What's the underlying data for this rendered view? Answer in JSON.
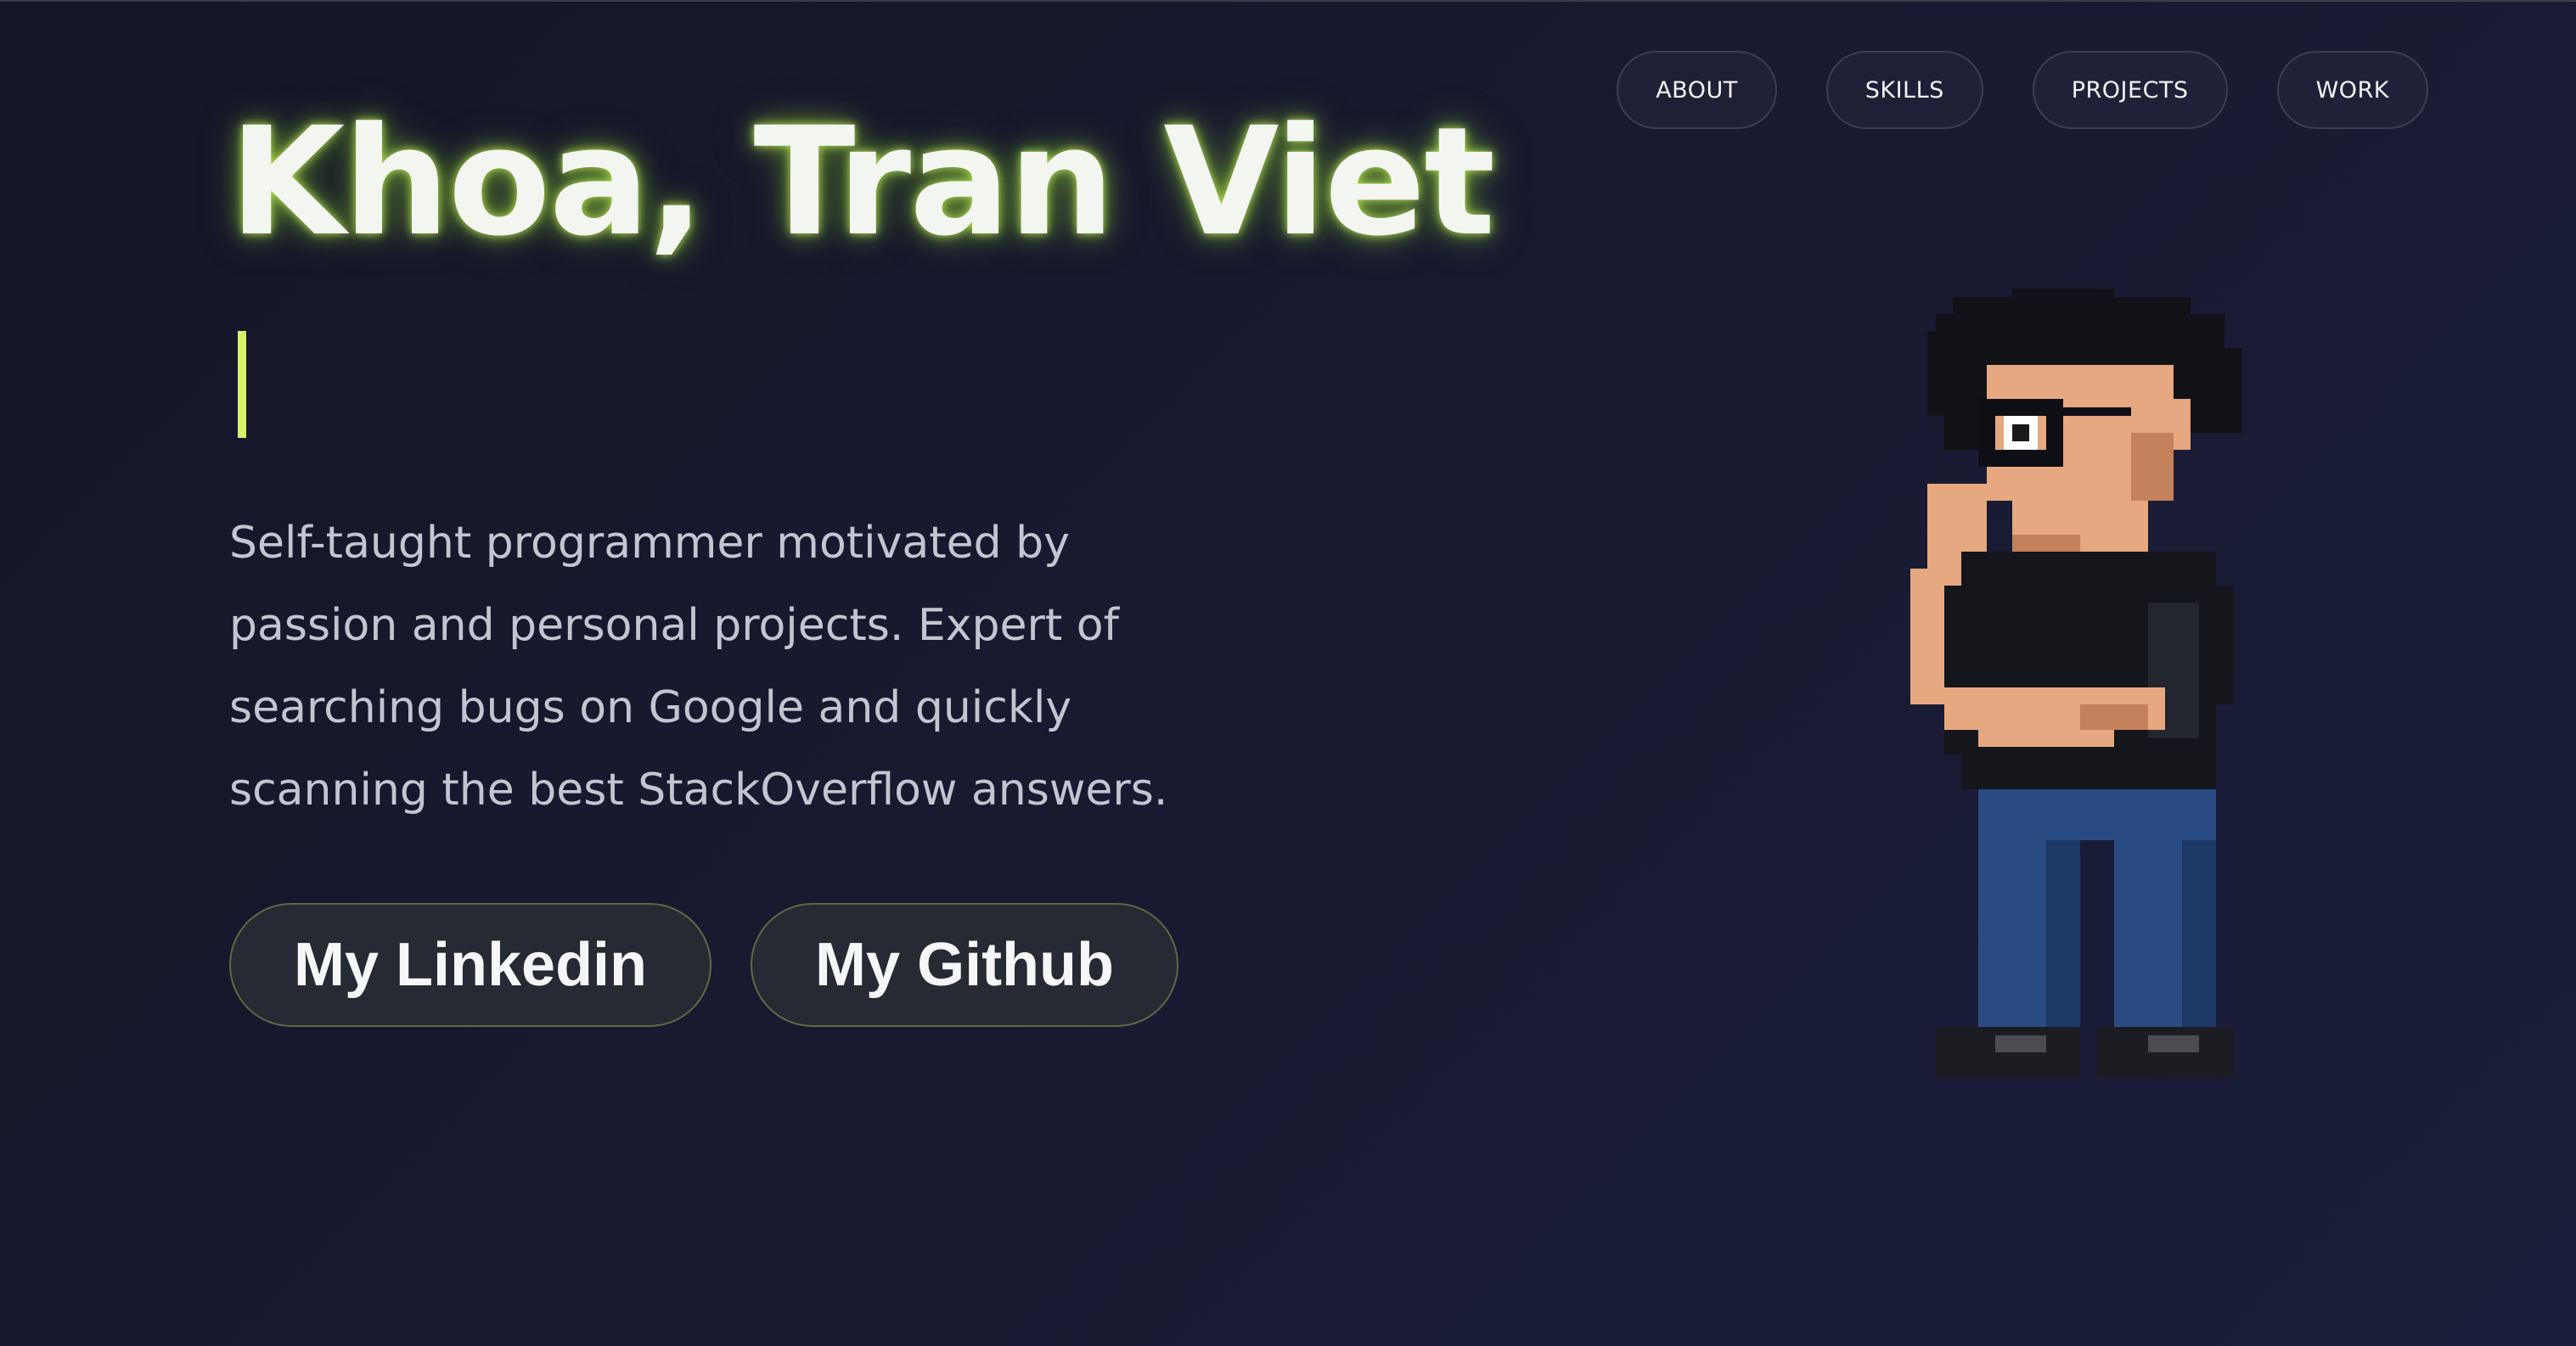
{
  "nav": {
    "items": [
      {
        "label": "ABOUT"
      },
      {
        "label": "SKILLS"
      },
      {
        "label": "PROJECTS"
      },
      {
        "label": "WORK"
      }
    ]
  },
  "hero": {
    "name": "Khoa, Tran Viet",
    "bio": "Self-taught programmer motivated by passion and personal projects. Expert of searching bugs on Google and quickly scanning the best StackOverflow answers.",
    "buttons": {
      "linkedin": "My Linkedin",
      "github": "My Github"
    }
  },
  "avatar": {
    "icon": "pixel-art-programmer-icon"
  },
  "colors": {
    "background": "#161829",
    "accent_glow": "#b8f060",
    "cursor": "#d4f26a",
    "text": "#f3f6f0",
    "muted_text": "#c3c6d0"
  }
}
